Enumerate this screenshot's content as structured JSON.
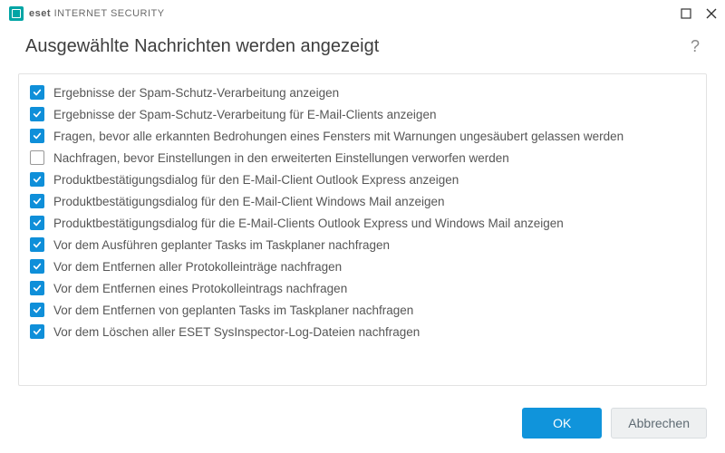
{
  "brand": {
    "bold": "eset",
    "rest": "INTERNET SECURITY"
  },
  "header": {
    "title": "Ausgewählte Nachrichten werden angezeigt"
  },
  "options": [
    {
      "checked": true,
      "label": "Ergebnisse der Spam-Schutz-Verarbeitung anzeigen"
    },
    {
      "checked": true,
      "label": "Ergebnisse der Spam-Schutz-Verarbeitung für E-Mail-Clients anzeigen"
    },
    {
      "checked": true,
      "label": "Fragen, bevor alle erkannten Bedrohungen eines Fensters mit Warnungen ungesäubert gelassen werden"
    },
    {
      "checked": false,
      "label": "Nachfragen, bevor Einstellungen in den erweiterten Einstellungen verworfen werden"
    },
    {
      "checked": true,
      "label": "Produktbestätigungsdialog für den E-Mail-Client Outlook Express anzeigen"
    },
    {
      "checked": true,
      "label": "Produktbestätigungsdialog für den E-Mail-Client Windows Mail anzeigen"
    },
    {
      "checked": true,
      "label": "Produktbestätigungsdialog für die E-Mail-Clients Outlook Express und Windows Mail anzeigen"
    },
    {
      "checked": true,
      "label": "Vor dem Ausführen geplanter Tasks im Taskplaner nachfragen"
    },
    {
      "checked": true,
      "label": "Vor dem Entfernen aller Protokolleinträge nachfragen"
    },
    {
      "checked": true,
      "label": "Vor dem Entfernen eines Protokolleintrags nachfragen"
    },
    {
      "checked": true,
      "label": "Vor dem Entfernen von geplanten Tasks im Taskplaner nachfragen"
    },
    {
      "checked": true,
      "label": "Vor dem Löschen aller ESET SysInspector-Log-Dateien nachfragen"
    }
  ],
  "footer": {
    "ok": "OK",
    "cancel": "Abbrechen"
  }
}
